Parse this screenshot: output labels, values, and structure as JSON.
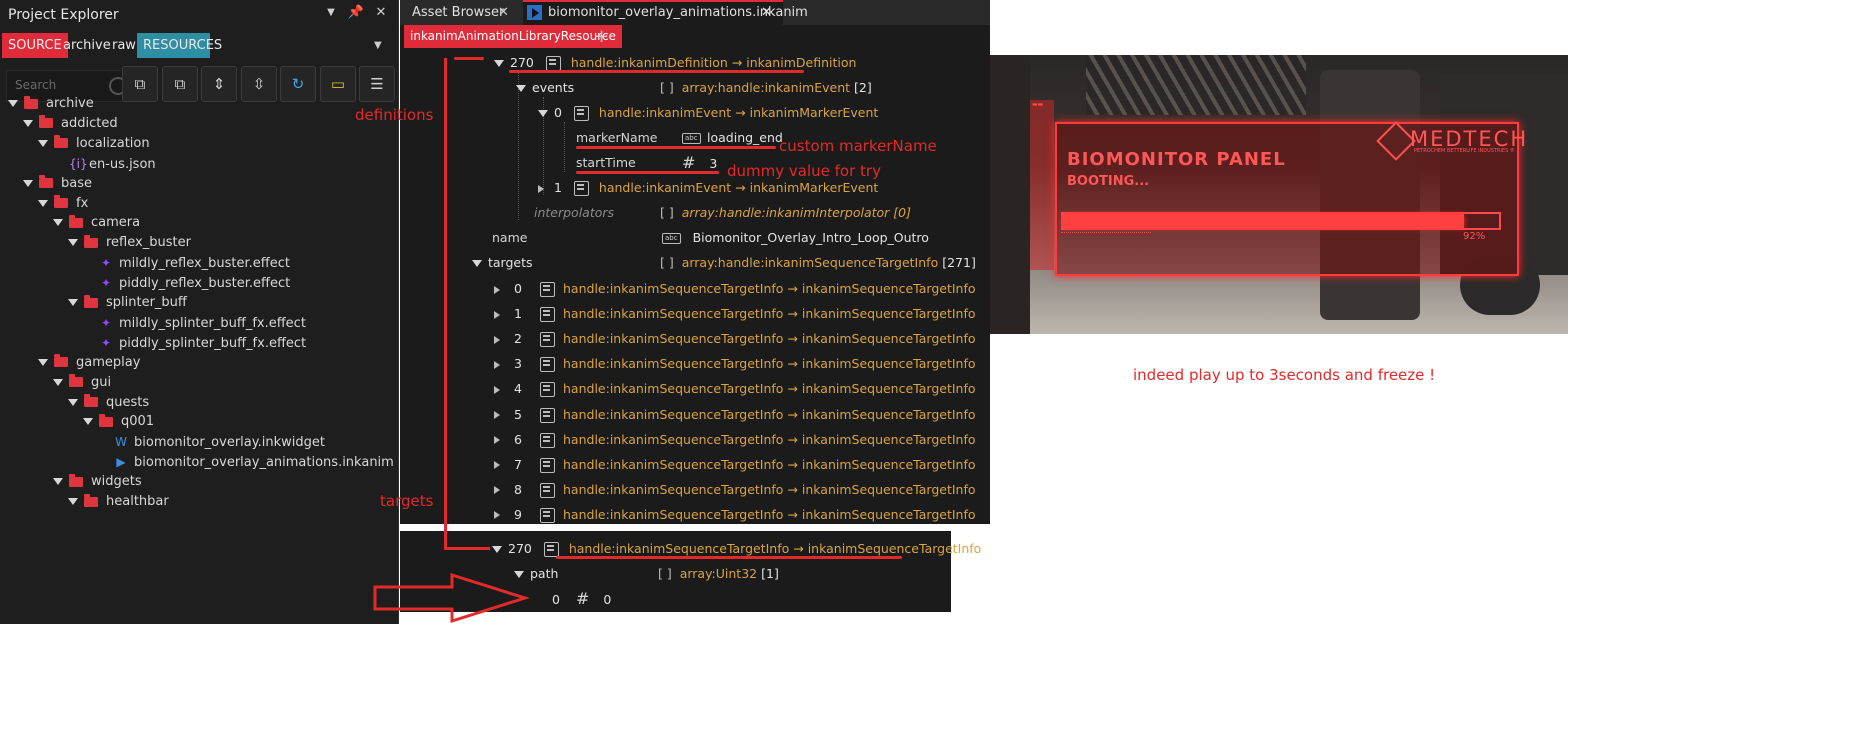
{
  "project_explorer": {
    "title": "Project Explorer",
    "filter_tabs": [
      "SOURCE",
      "archive",
      "raw",
      "RESOURCES"
    ],
    "search_placeholder": "Search",
    "tree": [
      {
        "label": "archive",
        "icon": "folder-icon"
      },
      {
        "label": "addicted",
        "icon": "folder-icon"
      },
      {
        "label": "localization",
        "icon": "folder-icon"
      },
      {
        "label": "en-us.json",
        "icon": "json-file-icon"
      },
      {
        "label": "base",
        "icon": "folder-icon"
      },
      {
        "label": "fx",
        "icon": "folder-icon"
      },
      {
        "label": "camera",
        "icon": "folder-icon"
      },
      {
        "label": "reflex_buster",
        "icon": "folder-icon"
      },
      {
        "label": "mildly_reflex_buster.effect",
        "icon": "effect-file-icon"
      },
      {
        "label": "piddly_reflex_buster.effect",
        "icon": "effect-file-icon"
      },
      {
        "label": "splinter_buff",
        "icon": "folder-icon"
      },
      {
        "label": "mildly_splinter_buff_fx.effect",
        "icon": "effect-file-icon"
      },
      {
        "label": "piddly_splinter_buff_fx.effect",
        "icon": "effect-file-icon"
      },
      {
        "label": "gameplay",
        "icon": "folder-icon"
      },
      {
        "label": "gui",
        "icon": "folder-icon"
      },
      {
        "label": "quests",
        "icon": "folder-icon"
      },
      {
        "label": "q001",
        "icon": "folder-icon"
      },
      {
        "label": "biomonitor_overlay.inkwidget",
        "icon": "inkwidget-file-icon"
      },
      {
        "label": "biomonitor_overlay_animations.inkanim",
        "icon": "inkanim-file-icon"
      },
      {
        "label": "widgets",
        "icon": "folder-icon"
      },
      {
        "label": "healthbar",
        "icon": "folder-icon"
      }
    ]
  },
  "editor": {
    "tabs": [
      "Asset Browser",
      "biomonitor_overlay_animations.inkanim"
    ],
    "resource_tab": "inkanimAnimationLibraryResource",
    "rows": {
      "def_index": "270",
      "def_value": "handle:inkanimDefinition → inkanimDefinition",
      "events_key": "events",
      "events_value": "array:handle:inkanimEvent",
      "events_count": "[2]",
      "ev0_index": "0",
      "ev0_value": "handle:inkanimEvent → inkanimMarkerEvent",
      "marker_key": "markerName",
      "marker_value": "loading_end",
      "start_key": "startTime",
      "start_value": "3",
      "ev1_index": "1",
      "ev1_value": "handle:inkanimEvent → inkanimMarkerEvent",
      "interp_key": "interpolators",
      "interp_value": "array:handle:inkanimInterpolator [0]",
      "name_key": "name",
      "name_value": "Biomonitor_Overlay_Intro_Loop_Outro",
      "targets_key": "targets",
      "targets_value": "array:handle:inkanimSequenceTargetInfo",
      "targets_count": "[271]",
      "target_value": "handle:inkanimSequenceTargetInfo → inkanimSequenceTargetInfo",
      "target_indices": [
        "0",
        "1",
        "2",
        "3",
        "4",
        "5",
        "6",
        "7",
        "8",
        "9"
      ]
    }
  },
  "bottom_panel": {
    "index": "270",
    "value": "handle:inkanimSequenceTargetInfo → inkanimSequenceTargetInfo",
    "path_key": "path",
    "path_value": "array:Uint32",
    "path_count": "[1]",
    "item_index": "0",
    "item_value": "0"
  },
  "annotations": {
    "definitions": "definitions",
    "targets": "targets",
    "custom_marker": "custom markerName",
    "dummy": "dummy value for try",
    "freeze": "indeed play up to 3seconds and freeze !"
  },
  "game_preview": {
    "brand": "MEDTECH",
    "brand_sub": "PETROCHEM BETTERLIFE INDUSTRIES ®",
    "panel_title": "BIOMONITOR PANEL",
    "status": "BOOTING...",
    "progress_label": "92%",
    "progress": 0.92
  },
  "colors": {
    "accent_red": "#e02b3b",
    "annotation_red": "#e32a2a",
    "value_orange": "#d9a441",
    "resources_tab": "#2e8ea4"
  }
}
